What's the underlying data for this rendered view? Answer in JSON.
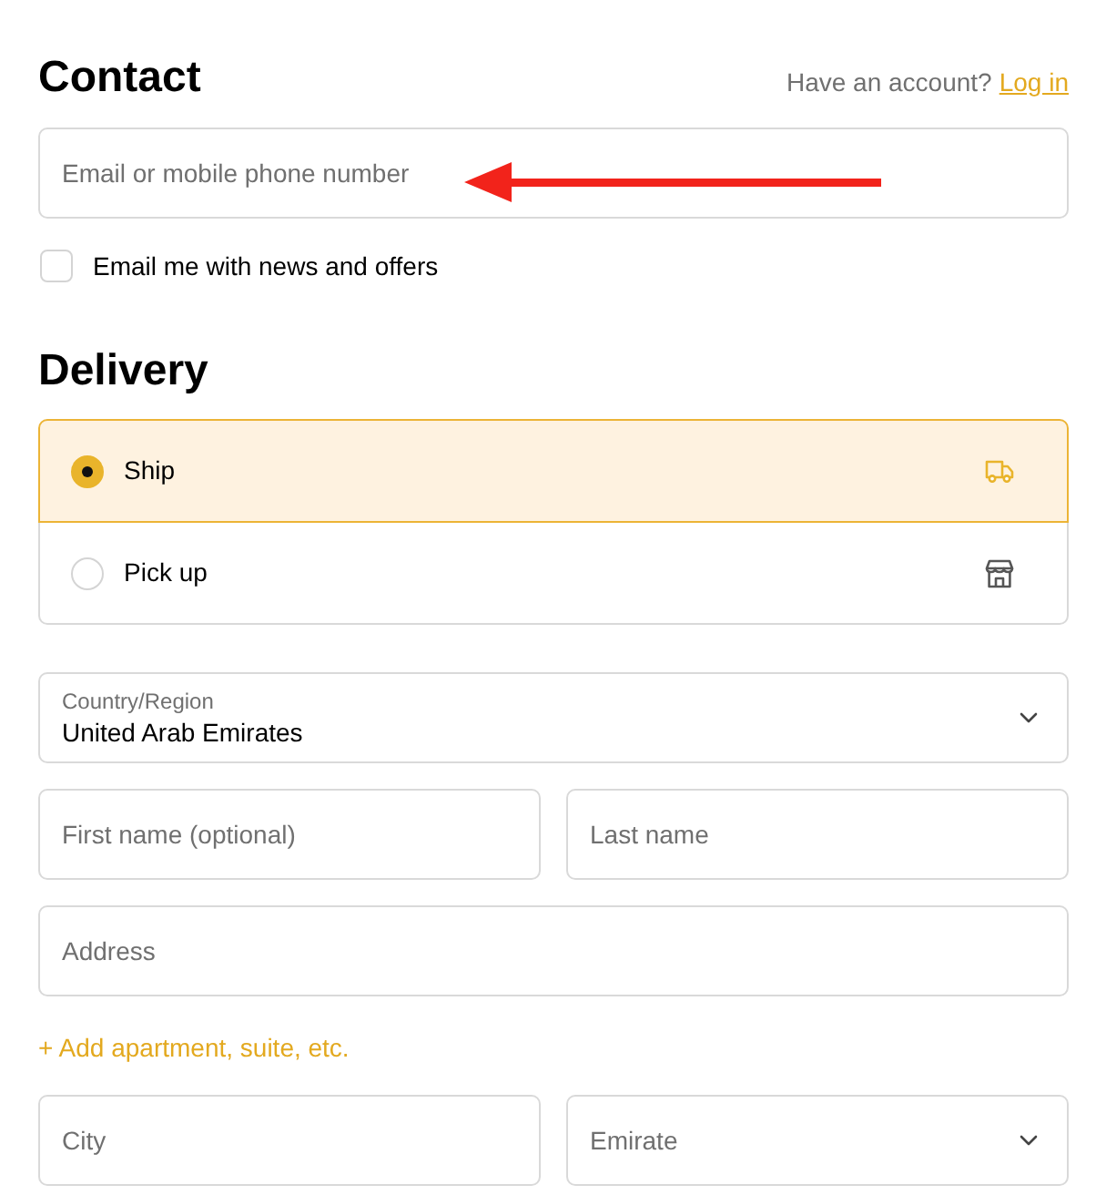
{
  "contact": {
    "title": "Contact",
    "account_prompt": "Have an account?",
    "login_link": "Log in",
    "email": {
      "placeholder": "Email or mobile phone number"
    },
    "newsletter": {
      "label": "Email me with news and offers",
      "checked": false
    }
  },
  "delivery": {
    "title": "Delivery",
    "methods": [
      {
        "kind": "ship",
        "label": "Ship",
        "selected": true
      },
      {
        "kind": "pickup",
        "label": "Pick up",
        "selected": false
      }
    ],
    "country": {
      "label": "Country/Region",
      "value": "United Arab Emirates"
    },
    "first_name": {
      "placeholder": "First name (optional)"
    },
    "last_name": {
      "placeholder": "Last name"
    },
    "address": {
      "placeholder": "Address"
    },
    "add_apartment_link": "+ Add apartment, suite, etc.",
    "city": {
      "placeholder": "City"
    },
    "emirate": {
      "placeholder": "Emirate"
    }
  }
}
